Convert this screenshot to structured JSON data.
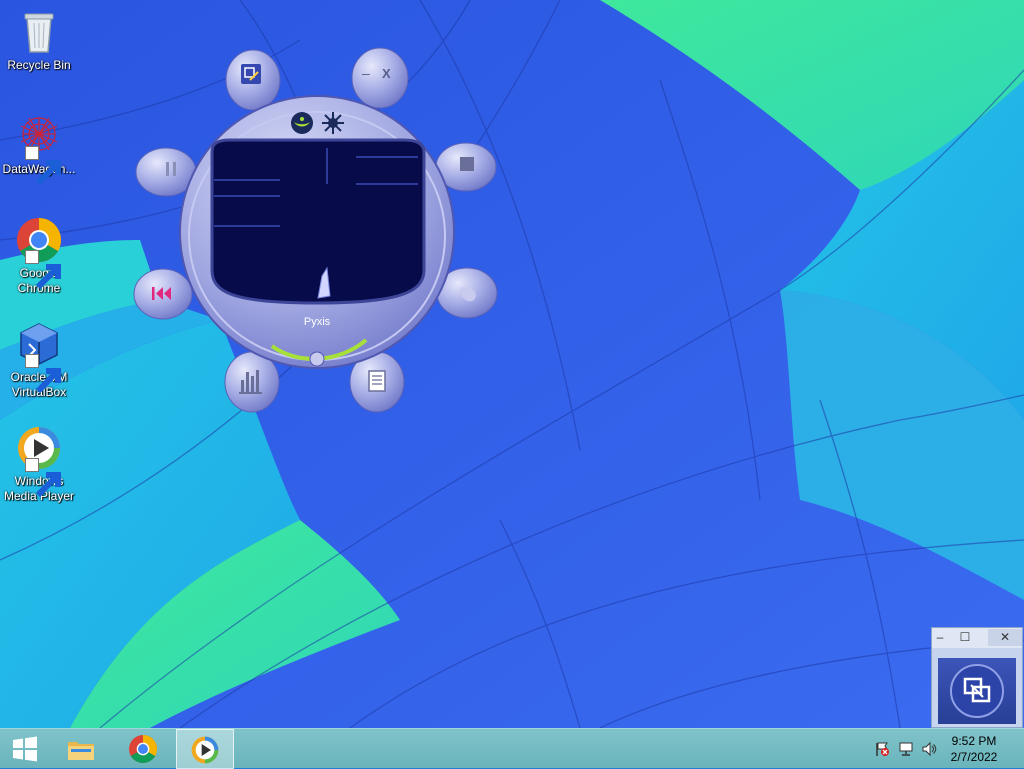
{
  "desktop": {
    "icons": [
      {
        "label": "Recycle Bin",
        "icon": "recycle-bin-icon"
      },
      {
        "label": "DataWagon...",
        "icon": "datawagon-icon"
      },
      {
        "label": "Google Chrome",
        "icon": "chrome-icon"
      },
      {
        "label": "Oracle VM VirtualBox",
        "icon": "virtualbox-icon"
      },
      {
        "label": "Windows Media Player",
        "icon": "wmp-icon"
      }
    ]
  },
  "player": {
    "skin_name": "Pyxis",
    "buttons": [
      "switch-to-full-mode-icon",
      "minimize-icon",
      "close-icon",
      "pause-icon",
      "stop-icon",
      "previous-icon",
      "next-icon",
      "equalizer-icon",
      "playlist-icon",
      "eye-icon",
      "visualization-icon"
    ],
    "minimize_label": "–",
    "close_label": "X"
  },
  "mini_window": {
    "minimize": "–",
    "maximize": "☐",
    "close": "✕"
  },
  "taskbar": {
    "start_icon": "windows-start-icon",
    "items": [
      "file-explorer-icon",
      "chrome-icon",
      "windows-media-player-icon"
    ],
    "tray": [
      "action-center-flag-icon",
      "network-icon",
      "volume-icon"
    ],
    "time": "9:52 PM",
    "date": "2/7/2022"
  },
  "colors": {
    "wallpaper_blue": "#2f5ee8",
    "wallpaper_cyan": "#22c9e2",
    "wallpaper_green": "#3fe89c",
    "taskbar": "#72bcc2",
    "skin_body": "#a9aee8"
  }
}
